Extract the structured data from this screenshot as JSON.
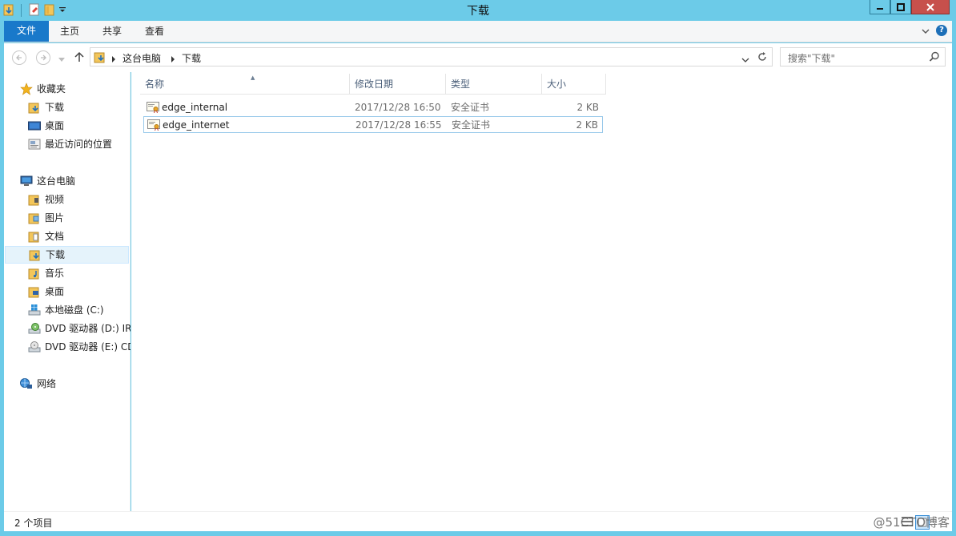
{
  "window": {
    "title": "下载"
  },
  "ribbon": {
    "tabs": [
      "文件",
      "主页",
      "共享",
      "查看"
    ]
  },
  "address": {
    "crumbs": [
      "这台电脑",
      "下载"
    ]
  },
  "search": {
    "placeholder": "搜索\"下载\""
  },
  "nav": {
    "favorites": {
      "label": "收藏夹",
      "items": [
        "下载",
        "桌面",
        "最近访问的位置"
      ]
    },
    "pc": {
      "label": "这台电脑",
      "items": [
        "视频",
        "图片",
        "文档",
        "下载",
        "音乐",
        "桌面",
        "本地磁盘 (C:)",
        "DVD 驱动器 (D:) IR",
        "DVD 驱动器 (E:) CD"
      ]
    },
    "network": {
      "label": "网络"
    }
  },
  "columns": [
    "名称",
    "修改日期",
    "类型",
    "大小"
  ],
  "files": [
    {
      "name": "edge_internal",
      "date": "2017/12/28 16:50",
      "type": "安全证书",
      "size": "2 KB"
    },
    {
      "name": "edge_internet",
      "date": "2017/12/28 16:55",
      "type": "安全证书",
      "size": "2 KB"
    }
  ],
  "status": {
    "count": "2 个项目"
  },
  "watermark": "@51CTO博客",
  "colors": {
    "frame": "#6ccbe8",
    "file_tab": "#1979ca",
    "selection": "#e5f3fb",
    "close": "#c7504c"
  }
}
